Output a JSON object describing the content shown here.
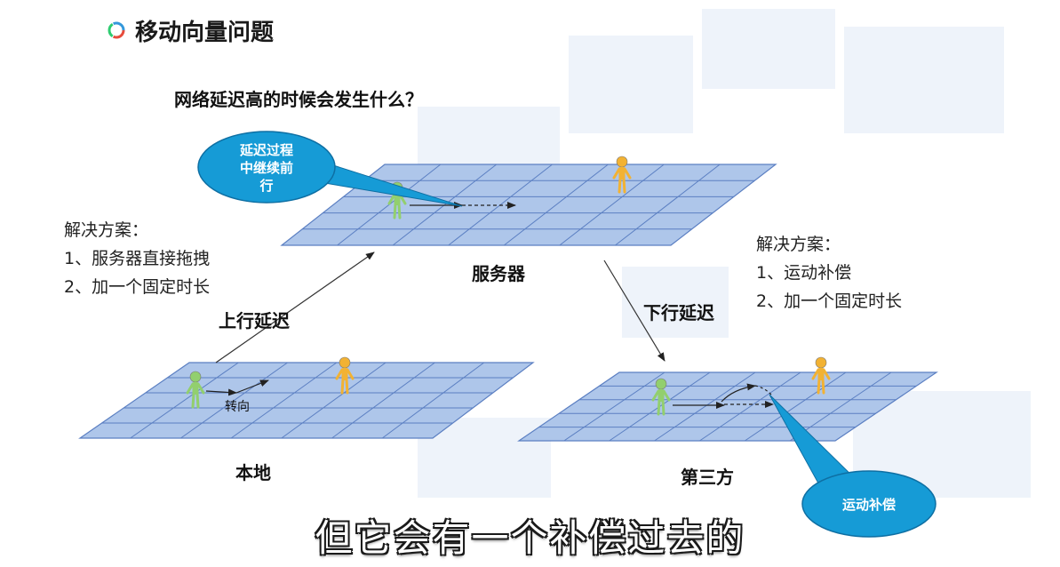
{
  "slide": {
    "title": "移动向量问题",
    "question": "网络延迟高的时候会发生什么？"
  },
  "planes": {
    "server": {
      "label": "服务器"
    },
    "local": {
      "label": "本地"
    },
    "third": {
      "label": "第三方"
    }
  },
  "arrows": {
    "uplink": "上行延迟",
    "downlink": "下行延迟",
    "turn": "转向"
  },
  "callouts": {
    "server_delay": {
      "lines": [
        "延迟过程",
        "中继续前",
        "行"
      ]
    },
    "compensation": {
      "text": "运动补偿"
    }
  },
  "solutions": {
    "left": {
      "heading": "解决方案：",
      "items": [
        "1、服务器直接拖拽",
        "2、加一个固定时长"
      ]
    },
    "right": {
      "heading": "解决方案：",
      "items": [
        "1、运动补偿",
        "2、加一个固定时长"
      ]
    }
  },
  "subtitle": "但它会有一个补偿过去的",
  "colors": {
    "grid_fill": "#aec6ea",
    "grid_line": "#5b7fc2",
    "callout": "#169bd6",
    "green_figure": "#92cf6e",
    "yellow_figure": "#f2b233"
  }
}
